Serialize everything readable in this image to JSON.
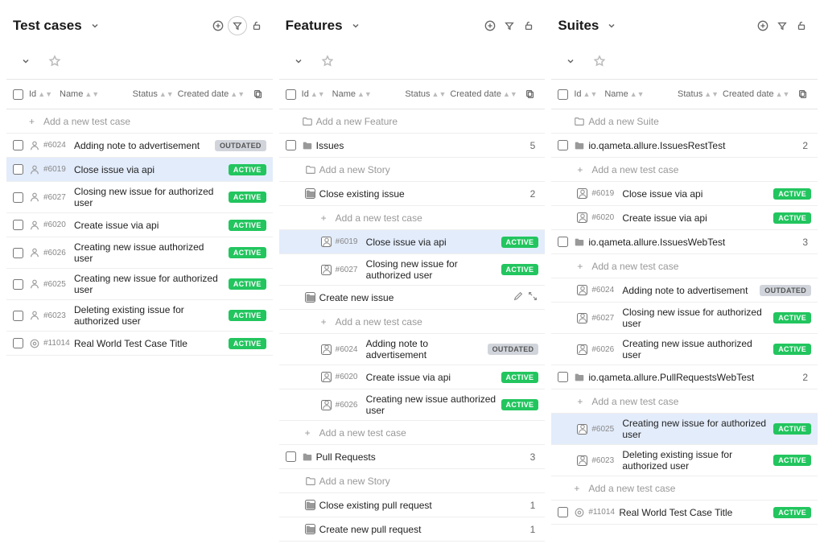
{
  "panels": {
    "testcases": {
      "title": "Test cases",
      "addLabel": "Add a new test case",
      "columns": {
        "id": "Id",
        "name": "Name",
        "status": "Status",
        "created": "Created date"
      },
      "rows": [
        {
          "id": "#6024",
          "name": "Adding note to advertisement",
          "status": "OUTDATED"
        },
        {
          "id": "#6019",
          "name": "Close issue via api",
          "status": "ACTIVE",
          "hl": true
        },
        {
          "id": "#6027",
          "name": "Closing new issue for authorized user",
          "status": "ACTIVE"
        },
        {
          "id": "#6020",
          "name": "Create issue via api",
          "status": "ACTIVE"
        },
        {
          "id": "#6026",
          "name": "Creating new issue authorized user",
          "status": "ACTIVE"
        },
        {
          "id": "#6025",
          "name": "Creating new issue for authorized user",
          "status": "ACTIVE"
        },
        {
          "id": "#6023",
          "name": "Deleting existing issue for authorized user",
          "status": "ACTIVE"
        },
        {
          "id": "#11014",
          "name": "Real World Test Case Title",
          "status": "ACTIVE",
          "icon": "target"
        }
      ]
    },
    "features": {
      "title": "Features",
      "addRootLabel": "Add a new Feature",
      "addStoryLabel": "Add a new Story",
      "addTestLabel": "Add a new test case",
      "columns": {
        "id": "Id",
        "name": "Name",
        "status": "Status",
        "created": "Created date"
      },
      "groups": [
        {
          "name": "Issues",
          "count": "5",
          "stories": [
            {
              "name": "Close existing issue",
              "count": "2",
              "tests": [
                {
                  "id": "#6019",
                  "name": "Close issue via api",
                  "status": "ACTIVE",
                  "hl": true
                },
                {
                  "id": "#6027",
                  "name": "Closing new issue for authorized user",
                  "status": "ACTIVE"
                }
              ]
            },
            {
              "name": "Create new issue",
              "editable": true,
              "tests": [
                {
                  "id": "#6024",
                  "name": "Adding note to advertisement",
                  "status": "OUTDATED"
                },
                {
                  "id": "#6020",
                  "name": "Create issue via api",
                  "status": "ACTIVE"
                },
                {
                  "id": "#6026",
                  "name": "Creating new issue authorized user",
                  "status": "ACTIVE"
                }
              ]
            }
          ],
          "trailingAdd": "Add a new test case"
        },
        {
          "name": "Pull Requests",
          "count": "3",
          "storiesSimple": [
            {
              "name": "Close existing pull request",
              "count": "1"
            },
            {
              "name": "Create new pull request",
              "count": "1"
            }
          ]
        }
      ]
    },
    "suites": {
      "title": "Suites",
      "addRootLabel": "Add a new Suite",
      "addTestLabel": "Add a new test case",
      "columns": {
        "id": "Id",
        "name": "Name",
        "status": "Status",
        "created": "Created date"
      },
      "groups": [
        {
          "name": "io.qameta.allure.IssuesRestTest",
          "count": "2",
          "tests": [
            {
              "id": "#6019",
              "name": "Close issue via api",
              "status": "ACTIVE"
            },
            {
              "id": "#6020",
              "name": "Create issue via api",
              "status": "ACTIVE"
            }
          ]
        },
        {
          "name": "io.qameta.allure.IssuesWebTest",
          "count": "3",
          "tests": [
            {
              "id": "#6024",
              "name": "Adding note to advertisement",
              "status": "OUTDATED"
            },
            {
              "id": "#6027",
              "name": "Closing new issue for authorized user",
              "status": "ACTIVE"
            },
            {
              "id": "#6026",
              "name": "Creating new issue authorized user",
              "status": "ACTIVE"
            }
          ]
        },
        {
          "name": "io.qameta.allure.PullRequestsWebTest",
          "count": "2",
          "tests": [
            {
              "id": "#6025",
              "name": "Creating new issue for authorized user",
              "status": "ACTIVE",
              "hl": true
            },
            {
              "id": "#6023",
              "name": "Deleting existing issue for authorized user",
              "status": "ACTIVE"
            }
          ]
        }
      ],
      "trailingAdd": "Add a new test case",
      "trailingTest": {
        "id": "#11014",
        "name": "Real World Test Case Title",
        "status": "ACTIVE",
        "icon": "target"
      }
    }
  }
}
